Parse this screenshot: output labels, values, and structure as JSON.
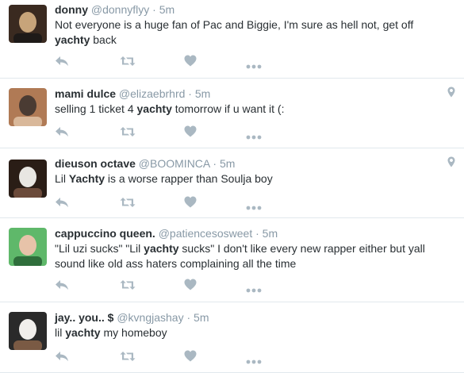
{
  "tweets": [
    {
      "name": "donny",
      "handle": "@donnyflyy",
      "sep": "·",
      "time": "5m",
      "text_parts": [
        {
          "t": "Not everyone is a huge fan of Pac and Biggie, I'm sure as hell not, get off ",
          "b": false
        },
        {
          "t": "yachty",
          "b": true
        },
        {
          "t": " back",
          "b": false
        }
      ],
      "has_geo": false,
      "avatar_colors": [
        "#3a2a20",
        "#c7a47a",
        "#1e1a18"
      ]
    },
    {
      "name": "mami dulce",
      "handle": "@elizaebrhrd",
      "sep": "·",
      "time": "5m",
      "text_parts": [
        {
          "t": "selling 1 ticket 4 ",
          "b": false
        },
        {
          "t": "yachty",
          "b": true
        },
        {
          "t": " tomorrow if u want it (:",
          "b": false
        }
      ],
      "has_geo": true,
      "avatar_colors": [
        "#b07a55",
        "#4a3b33",
        "#d9b89a"
      ]
    },
    {
      "name": "dieuson octave",
      "handle": "@BOOMINCA",
      "sep": "·",
      "time": "5m",
      "text_parts": [
        {
          "t": "Lil ",
          "b": false
        },
        {
          "t": "Yachty",
          "b": true
        },
        {
          "t": " is a worse rapper than Soulja boy",
          "b": false
        }
      ],
      "has_geo": true,
      "avatar_colors": [
        "#2a1d16",
        "#e8e6e2",
        "#6b4a3a"
      ]
    },
    {
      "name": "cappuccino queen.",
      "handle": "@patiencesosweet",
      "sep": "·",
      "time": "5m",
      "text_parts": [
        {
          "t": "\"Lil uzi sucks\" \"Lil ",
          "b": false
        },
        {
          "t": "yachty",
          "b": true
        },
        {
          "t": " sucks\" I don't like every new rapper either but yall sound like old ass haters complaining all the time",
          "b": false
        }
      ],
      "has_geo": false,
      "avatar_colors": [
        "#5fb86a",
        "#e7c3a9",
        "#2f6e3b"
      ]
    },
    {
      "name": "jay.. you.. $",
      "handle": "@kvngjashay",
      "sep": "·",
      "time": "5m",
      "text_parts": [
        {
          "t": "lil ",
          "b": false
        },
        {
          "t": "yachty",
          "b": true
        },
        {
          "t": " my homeboy",
          "b": false
        }
      ],
      "has_geo": false,
      "avatar_colors": [
        "#2a2a2a",
        "#f1efec",
        "#7a5a44"
      ]
    }
  ],
  "icons": {
    "reply": "reply-icon",
    "retweet": "retweet-icon",
    "like": "heart-icon",
    "more": "more-icon",
    "geo": "location-pin-icon"
  },
  "colors": {
    "name": "#292f33",
    "meta": "#8899a6",
    "icon": "#aab8c2",
    "divider": "#e1e8ed"
  }
}
